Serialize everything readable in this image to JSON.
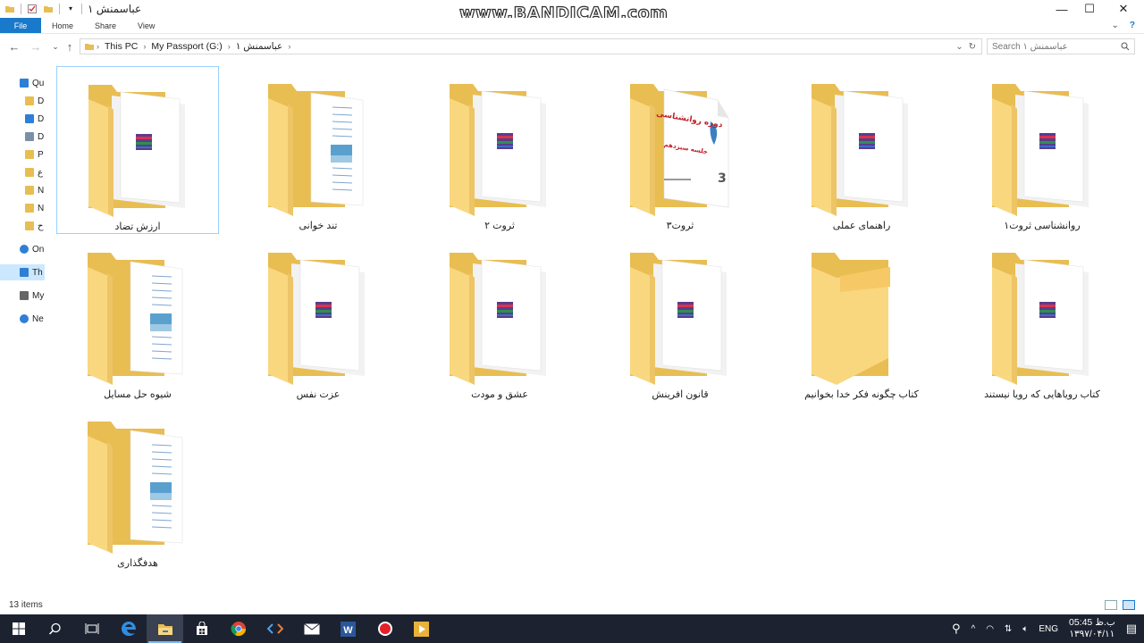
{
  "window": {
    "title": "عباسمنش ۱",
    "watermark": "www.BANDICAM.com",
    "controls": {
      "minimize": "—",
      "maximize": "☐",
      "close": "✕"
    }
  },
  "ribbon": {
    "tabs": [
      "File",
      "Home",
      "Share",
      "View"
    ]
  },
  "address": {
    "crumbs": [
      "This PC",
      "My Passport (G:)",
      "عباسمنش ۱"
    ],
    "search_placeholder": "Search عباسمنش ۱"
  },
  "nav": {
    "items": [
      {
        "label": "Qu",
        "icon": "star-icon"
      },
      {
        "label": "D",
        "icon": "folder-icon"
      },
      {
        "label": "D",
        "icon": "download-folder-icon"
      },
      {
        "label": "D",
        "icon": "documents-folder-icon"
      },
      {
        "label": "P",
        "icon": "pictures-folder-icon"
      },
      {
        "label": "ع",
        "icon": "folder-icon"
      },
      {
        "label": "N",
        "icon": "folder-icon"
      },
      {
        "label": "N",
        "icon": "folder-icon"
      },
      {
        "label": "ح",
        "icon": "folder-icon"
      },
      {
        "label": "On",
        "icon": "onedrive-icon"
      },
      {
        "label": "Th",
        "icon": "this-pc-icon"
      },
      {
        "label": "My",
        "icon": "drive-icon"
      },
      {
        "label": "Ne",
        "icon": "network-icon"
      }
    ]
  },
  "folders": [
    {
      "name": "ارزش تضاد",
      "preview": "winrar"
    },
    {
      "name": "تند خوانی",
      "preview": "document"
    },
    {
      "name": "ثروت ۲",
      "preview": "winrar"
    },
    {
      "name": "ثروت۳",
      "preview": "book"
    },
    {
      "name": "راهنمای عملی",
      "preview": "winrar"
    },
    {
      "name": "روانشناسی ثروت۱",
      "preview": "winrar"
    },
    {
      "name": "شیوه حل مسایل",
      "preview": "document"
    },
    {
      "name": "عزت نفس",
      "preview": "winrar"
    },
    {
      "name": "عشق و مودت",
      "preview": "winrar"
    },
    {
      "name": "قانون افرینش",
      "preview": "winrar"
    },
    {
      "name": "کتاب چگونه فکر خدا بخوانیم",
      "preview": "empty"
    },
    {
      "name": "کتاب رویاهایی که رویا نیستند",
      "preview": "winrar"
    },
    {
      "name": "هدفگذاری",
      "preview": "document"
    }
  ],
  "book_preview": {
    "title": "دوره روانشناسی",
    "subtitle": "جلسه سیزدهم"
  },
  "status": {
    "item_count": "13 items"
  },
  "taskbar": {
    "apps": [
      "start-icon",
      "search-icon",
      "task-view-icon",
      "edge-icon",
      "file-explorer-icon",
      "store-icon",
      "chrome-icon",
      "code-editor-icon",
      "mail-icon",
      "word-icon",
      "record-icon",
      "media-player-icon"
    ],
    "lang": "ENG",
    "time": "05:45 ب.ظ",
    "date": "۱۳۹۷/۰۴/۱۱"
  },
  "colors": {
    "accent": "#1979ca",
    "folder_back": "#e8bd52",
    "folder_front": "#f9d77f",
    "selection_border": "#99d1ff",
    "taskbar": "#1c2230"
  }
}
